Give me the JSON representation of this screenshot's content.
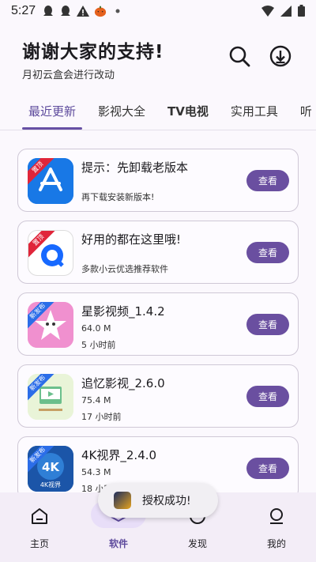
{
  "status_bar": {
    "time": "5:27"
  },
  "header": {
    "title": "谢谢大家的支持!",
    "subtitle": "月初云盒会进行改动"
  },
  "tabs": [
    {
      "label": "最近更新"
    },
    {
      "label": "影视大全"
    },
    {
      "label": "TV电视"
    },
    {
      "label": "实用工具"
    },
    {
      "label": "听"
    }
  ],
  "apps": [
    {
      "name": "提示：先卸载老版本",
      "desc": "再下载安装新版本!",
      "ribbon": "置顶",
      "button": "查看"
    },
    {
      "name": "好用的都在这里哦!",
      "desc": "多款小云优选推荐软件",
      "ribbon": "置顶",
      "button": "查看"
    },
    {
      "name": "星影视频_1.4.2",
      "size": "64.0 M",
      "time": "5 小时前",
      "ribbon": "新发布",
      "button": "查看"
    },
    {
      "name": "追忆影视_2.6.0",
      "size": "75.4 M",
      "time": "17 小时前",
      "ribbon": "新发布",
      "button": "查看"
    },
    {
      "name": "4K视界_2.4.0",
      "size": "54.3 M",
      "time": "18 小时前",
      "ribbon": "新发布",
      "button": "查看",
      "icon_text": "4K视界"
    }
  ],
  "toast": {
    "text": "授权成功!"
  },
  "bottom_nav": [
    {
      "label": "主页",
      "icon": "home-icon"
    },
    {
      "label": "软件",
      "icon": "apps-icon",
      "active": true
    },
    {
      "label": "发现",
      "icon": "discover-icon"
    },
    {
      "label": "我的",
      "icon": "profile-icon"
    }
  ],
  "colors": {
    "accent": "#6a4fa0",
    "nav_bg": "#f3edf7",
    "pill": "#e8def8"
  }
}
